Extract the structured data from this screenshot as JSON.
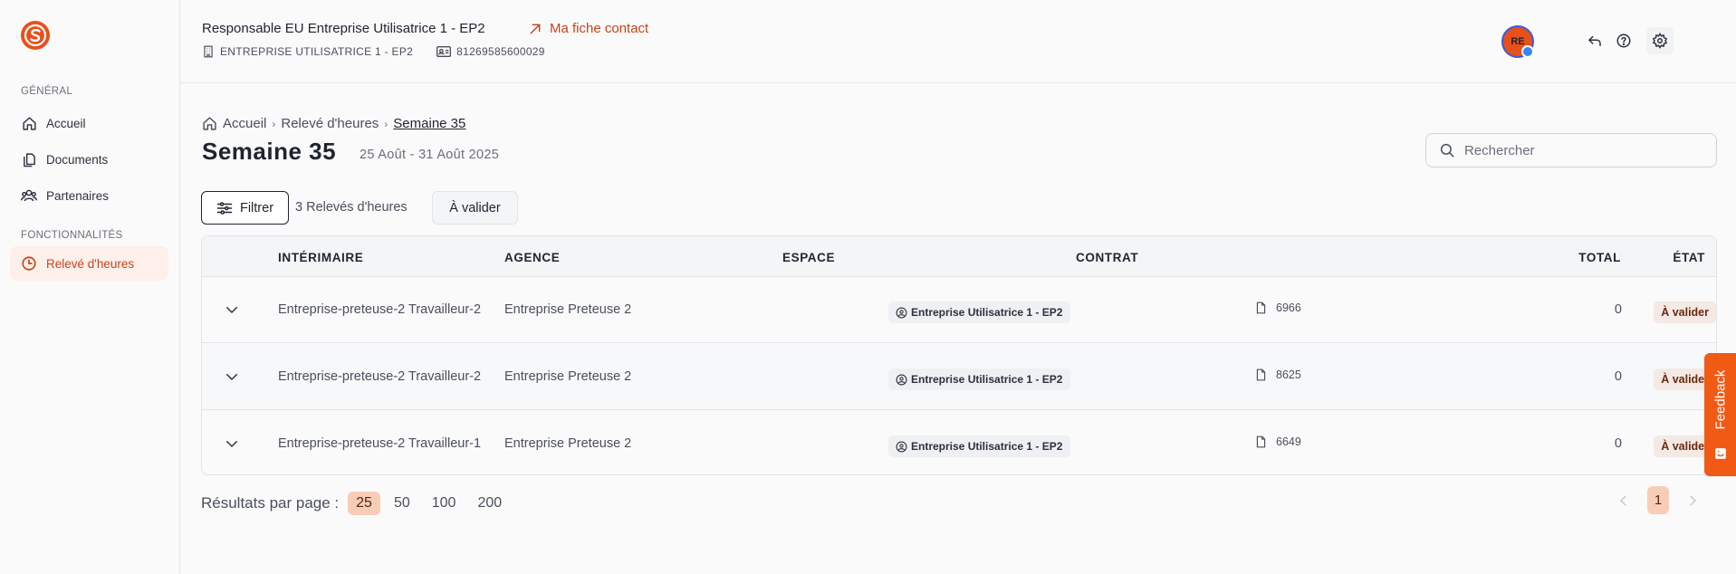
{
  "sidebar": {
    "section_general": "GÉNÉRAL",
    "section_features": "FONCTIONNALITÉS",
    "items": [
      {
        "label": "Accueil",
        "icon": "home-icon"
      },
      {
        "label": "Documents",
        "icon": "documents-icon"
      },
      {
        "label": "Partenaires",
        "icon": "partners-icon"
      },
      {
        "label": "Relevé d'heures",
        "icon": "clock-icon"
      }
    ]
  },
  "header": {
    "title": "Responsable EU Entreprise Utilisatrice 1 - EP2",
    "contact_link": "Ma fiche contact",
    "company": "ENTREPRISE UTILISATRICE 1 - EP2",
    "siret": "81269585600029",
    "avatar_initials": "RE"
  },
  "breadcrumb": [
    "Accueil",
    "Relevé d'heures",
    "Semaine 35"
  ],
  "page": {
    "title": "Semaine 35",
    "dates": "25 Août - 31 Août 2025"
  },
  "search": {
    "placeholder": "Rechercher"
  },
  "toolbar": {
    "filter_label": "Filtrer",
    "count_label": "3 Relevés d'heures",
    "status_filter": "À valider"
  },
  "table": {
    "columns": [
      "INTÉRIMAIRE",
      "AGENCE",
      "ESPACE",
      "CONTRAT",
      "TOTAL",
      "ÉTAT"
    ],
    "rows": [
      {
        "interimaire": "Entreprise-preteuse-2 Travailleur-2",
        "agence": "Entreprise Preteuse 2",
        "espace": "Entreprise Utilisatrice 1 - EP2",
        "contrat": "6966",
        "total": "0",
        "etat": "À valider"
      },
      {
        "interimaire": "Entreprise-preteuse-2 Travailleur-2",
        "agence": "Entreprise Preteuse 2",
        "espace": "Entreprise Utilisatrice 1 - EP2",
        "contrat": "8625",
        "total": "0",
        "etat": "À valider"
      },
      {
        "interimaire": "Entreprise-preteuse-2 Travailleur-1",
        "agence": "Entreprise Preteuse 2",
        "espace": "Entreprise Utilisatrice 1 - EP2",
        "contrat": "6649",
        "total": "0",
        "etat": "À valider"
      }
    ]
  },
  "pagination": {
    "per_page_label": "Résultats par page :",
    "options": [
      "25",
      "50",
      "100",
      "200"
    ],
    "selected": "25",
    "current_page": "1"
  },
  "feedback": {
    "label": "Feedback"
  },
  "colors": {
    "accent": "#e8501a",
    "accent_text": "#c7441a",
    "chip_selected": "#f8cdb8"
  }
}
